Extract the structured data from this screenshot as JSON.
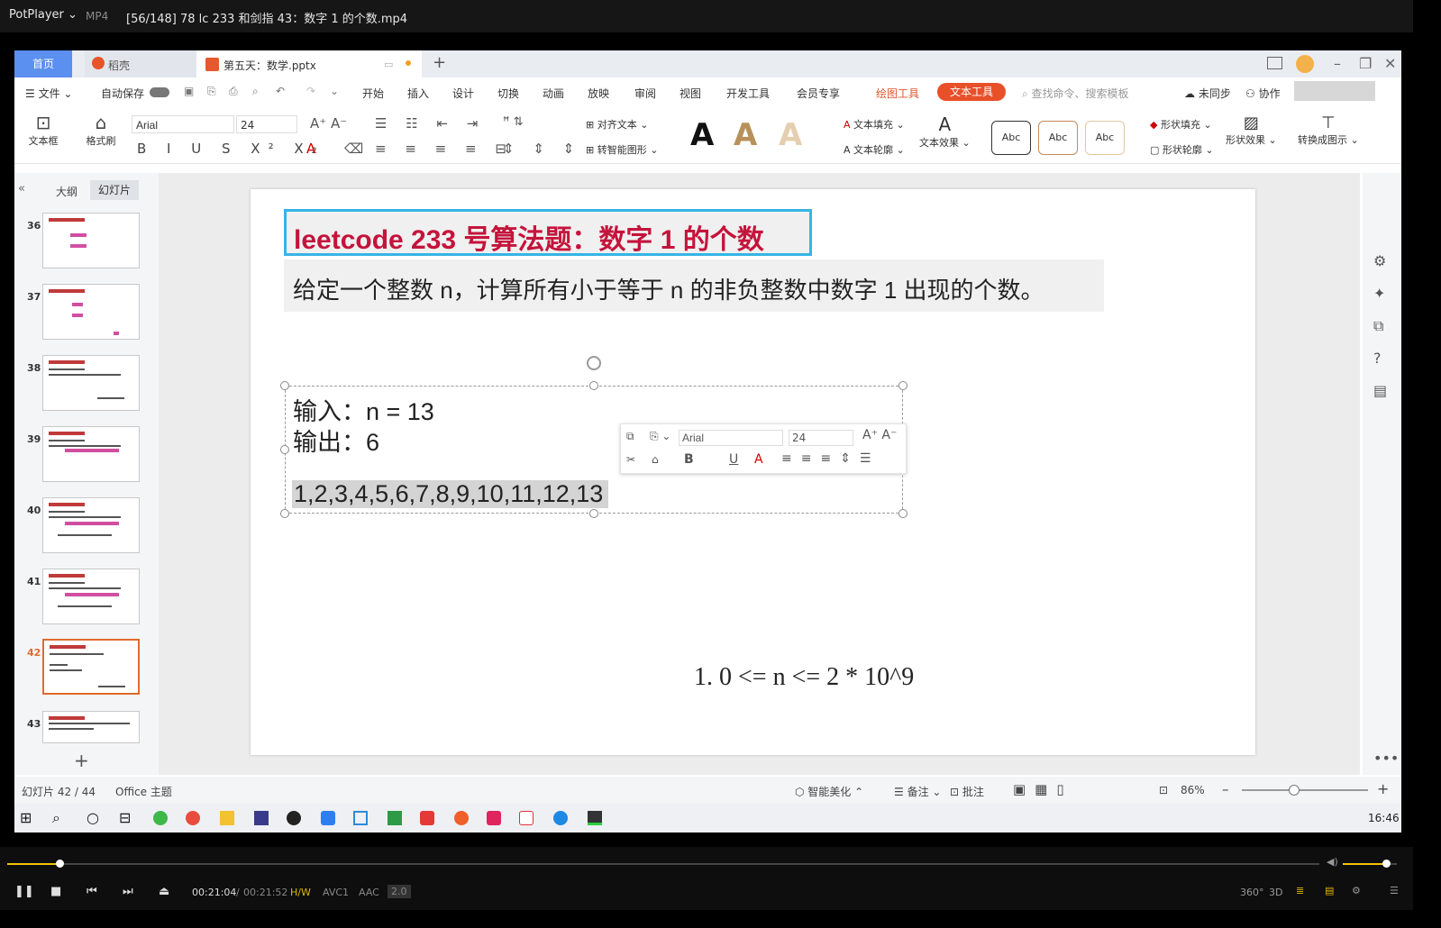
{
  "player": {
    "brand": "PotPlayer",
    "format": "MP4",
    "filename": "[56/148] 78 lc 233 和剑指 43：数字 1 的个数.mp4",
    "time_current": "00:21:04",
    "time_sep": "/",
    "time_total": "00:21:52",
    "hw": "H/W",
    "codec_v": "AVC1",
    "codec_a": "AAC",
    "channels": "2.0",
    "btn_360": "360°",
    "btn_3d": "3D",
    "progress": 0.04,
    "volume": 0.8
  },
  "wps": {
    "tabs": {
      "home": "首页",
      "dao": "稻壳",
      "file": "第五天：数学.pptx"
    },
    "menu": {
      "file": "文件",
      "autosave": "自动保存",
      "items": [
        "开始",
        "插入",
        "设计",
        "切换",
        "动画",
        "放映",
        "审阅",
        "视图",
        "开发工具",
        "会员专享"
      ],
      "draw_tools": "绘图工具",
      "text_tools": "文本工具",
      "search": "查找命令、搜索模板",
      "unsync": "未同步",
      "collab": "协作"
    },
    "ribbon": {
      "textbox": "文本框",
      "format_brush": "格式刷",
      "font": "Arial",
      "size": "24",
      "align_text": "对齐文本",
      "smartart": "转智能图形",
      "text_fill": "文本填充",
      "text_outline": "文本轮廓",
      "text_effect": "文本效果",
      "abc": "Abc",
      "shape_fill": "形状填充",
      "shape_outline": "形状轮廓",
      "shape_effect": "形状效果",
      "convert_icon": "转换成图示",
      "big_a": "A"
    },
    "sidebar": {
      "outline": "大纲",
      "slides": "幻灯片",
      "thumbs": [
        "36",
        "37",
        "38",
        "39",
        "40",
        "41",
        "42",
        "43"
      ],
      "active": "42"
    },
    "slide": {
      "title": "leetcode 233 号算法题：数字 1 的个数",
      "desc": "给定一个整数 n，计算所有小于等于 n 的非负整数中数字 1 出现的个数。",
      "input": "输入：n = 13",
      "output": "输出：6",
      "seq": "1,2,3,4,5,6,7,8,9,10,11,12,13",
      "constraint": "1. 0 <= n <= 2 * 10^9"
    },
    "mini_toolbar": {
      "font": "Arial",
      "size": "24",
      "bold": "B",
      "underline": "U"
    },
    "status": {
      "slide_count": "幻灯片 42 / 44",
      "theme": "Office 主题",
      "beautify": "智能美化",
      "notes": "备注",
      "comments": "批注",
      "zoom": "86%"
    },
    "clock": "16:46"
  }
}
